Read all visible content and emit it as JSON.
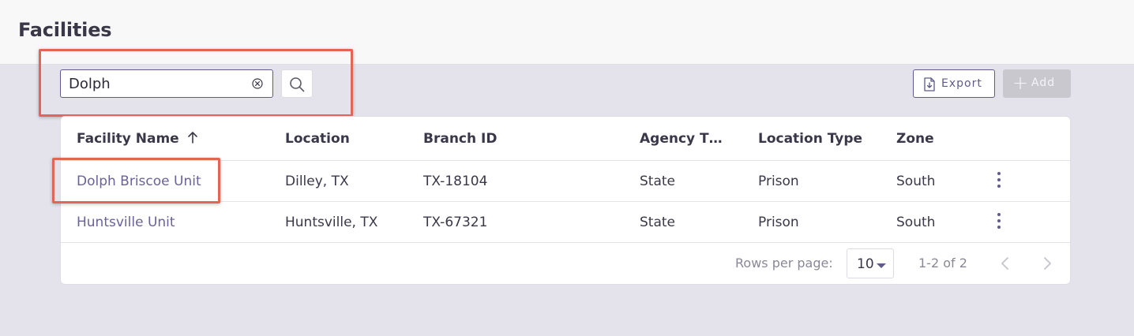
{
  "header": {
    "title": "Facilities"
  },
  "search": {
    "value": "Dolph",
    "placeholder": ""
  },
  "toolbar": {
    "export_label": "Export",
    "add_label": "Add"
  },
  "table": {
    "columns": [
      "Facility Name",
      "Location",
      "Branch ID",
      "Agency T…",
      "Location Type",
      "Zone"
    ],
    "sort": {
      "column": "Facility Name",
      "direction": "ascending"
    },
    "rows": [
      {
        "name": "Dolph Briscoe Unit",
        "location": "Dilley, TX",
        "branch_id": "TX-18104",
        "agency_type": "State",
        "location_type": "Prison",
        "zone": "South"
      },
      {
        "name": "Huntsville Unit",
        "location": "Huntsville, TX",
        "branch_id": "TX-67321",
        "agency_type": "State",
        "location_type": "Prison",
        "zone": "South"
      }
    ]
  },
  "pagination": {
    "rows_per_page_label": "Rows per page:",
    "rows_per_page": "10",
    "range": "1-2 of 2"
  },
  "colors": {
    "accent": "#5f5a8a",
    "link": "#6a629a",
    "highlight": "#e26556",
    "background": "#e4e2ea"
  },
  "icons": {
    "clear": "clear-circle-icon",
    "search": "search-icon",
    "export": "file-download-icon",
    "sort": "arrow-up-icon",
    "row_menu": "kebab-menu-icon"
  }
}
